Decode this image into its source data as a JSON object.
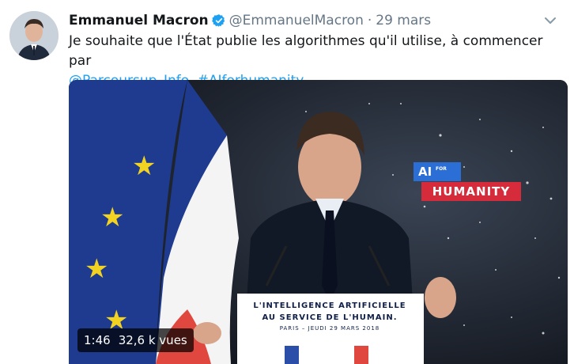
{
  "tweet": {
    "author_name": "Emmanuel Macron",
    "handle": "@EmmanuelMacron",
    "separator": "·",
    "date": "29 mars",
    "text_line1": "Je souhaite que l'État publie les algorithmes qu'il utilise, à commencer par",
    "mention": "@Parcoursup_Info",
    "text_sep": ". ",
    "hashtag": "#AIforhumanity"
  },
  "media": {
    "duration": "1:46",
    "views": "32,6 k vues",
    "sign_line1": "L'INTELLIGENCE ARTIFICIELLE",
    "sign_line2": "AU SERVICE DE L'HUMAIN.",
    "sign_line3": "PARIS – JEUDI 29 MARS 2018",
    "logo_ai": "AI",
    "logo_for": "FOR",
    "logo_humanity": "HUMANITY"
  },
  "colors": {
    "link": "#1da1f2",
    "verified": "#1da1f2",
    "muted": "#657786",
    "humanity_red": "#d62b3a",
    "ai_blue": "#2b6fd6"
  },
  "icons": {
    "verified": "verified-badge-icon",
    "caret": "chevron-down-icon"
  }
}
